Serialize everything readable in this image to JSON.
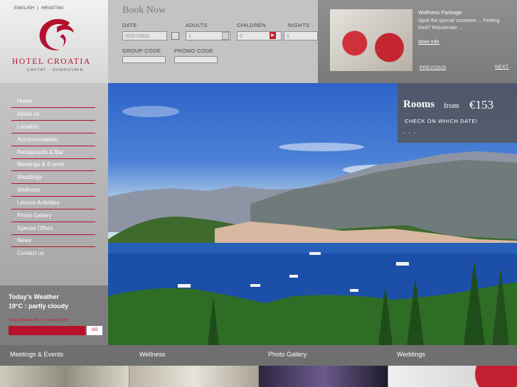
{
  "header": {
    "lang": [
      "ENGLISH",
      "HRVATSKI"
    ],
    "logo": {
      "name": "HOTEL CROATIA",
      "location": "CAVTAT · DUBROVNIK"
    }
  },
  "booking": {
    "title": "Book Now",
    "date_label": "DATE",
    "date_value": "02/07/2011",
    "adults_label": "ADULTS",
    "adults_value": "1",
    "children_label": "CHILDREN",
    "children_value": "0",
    "nights_label": "NIGHTS",
    "nights_value": "1",
    "group_code_label": "GROUP CODE",
    "promo_code_label": "PROMO CODE"
  },
  "promo": {
    "title": "Wellness Package",
    "text": "Spoil the special someone ... Feeling tired? Rejuvenate ...",
    "more": "More Info",
    "prev": "PREVIOUS",
    "next": "NEXT"
  },
  "nav": [
    "Home",
    "About us",
    "Location",
    "Accommodation",
    "Restaurants & Bar",
    "Meetings & Events",
    "Weddings",
    "Wellness",
    "Leisure Activities",
    "Photo Gallery",
    "Special Offers",
    "News",
    "Contact us"
  ],
  "weather": {
    "title": "Today's Weather",
    "value": "19°C : partly cloudy"
  },
  "newsletter": {
    "label": "Stay updated with our special offer",
    "go": "GO"
  },
  "rooms": {
    "word": "Rooms",
    "from": "from",
    "price": "€153",
    "check": "CHECK ON WHICH DATE!",
    "dots": "• • •"
  },
  "bottom_links": [
    "Meetings & Events",
    "Wellness",
    "Photo Gallery",
    "Weddings"
  ],
  "colors": {
    "accent": "#b3122f",
    "sidebar": "#b5b5b5",
    "bar": "#6f6f6f"
  }
}
